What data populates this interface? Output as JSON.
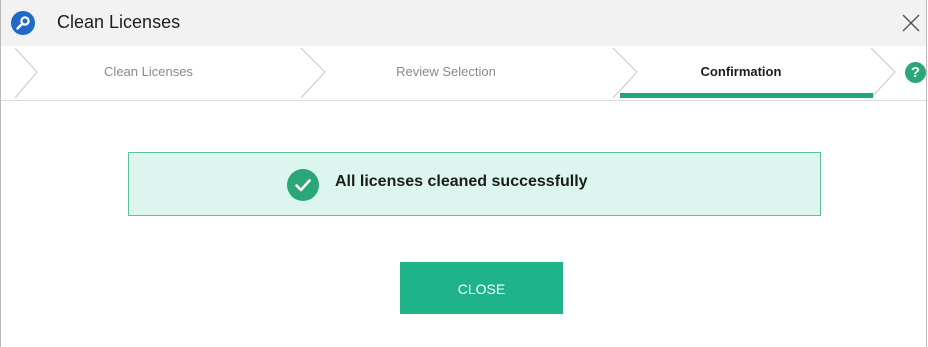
{
  "window": {
    "title": "Clean Licenses",
    "app_icon": "key-icon",
    "close_icon": "close-icon"
  },
  "wizard": {
    "steps": [
      {
        "label": "Clean Licenses",
        "state": "completed"
      },
      {
        "label": "Review Selection",
        "state": "completed"
      },
      {
        "label": "Confirmation",
        "state": "active"
      }
    ],
    "help_icon": "help-icon",
    "help_glyph": "?"
  },
  "message": {
    "text": "All licenses cleaned successfully",
    "icon": "checkmark-icon",
    "status": "success"
  },
  "actions": {
    "close_label": "CLOSE"
  },
  "colors": {
    "accent": "#1fb38a",
    "success_bg": "#dcf5ee",
    "success_border": "#5cc29e",
    "app_icon_bg": "#1f69c9"
  }
}
